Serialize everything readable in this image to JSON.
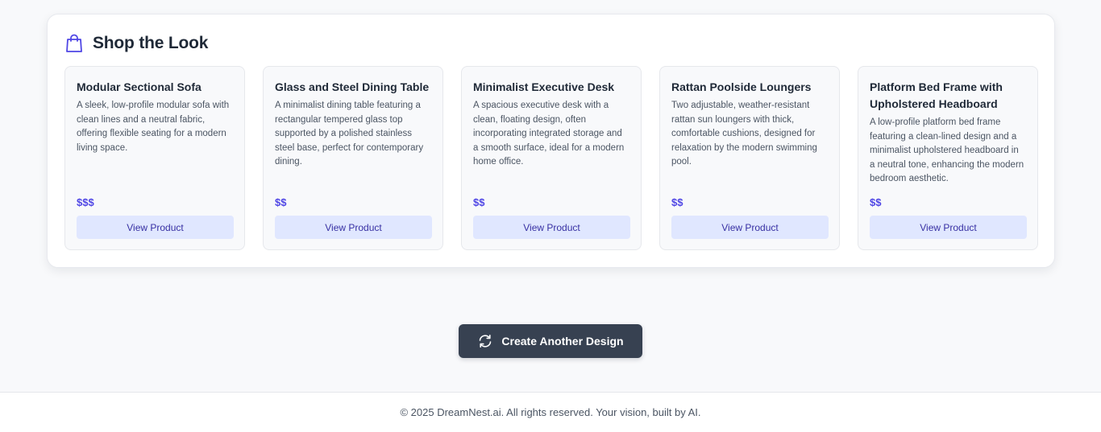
{
  "shop": {
    "title": "Shop the Look",
    "icon": "shopping-bag-icon",
    "accent_color": "#4f46e5",
    "products": [
      {
        "name": "Modular Sectional Sofa",
        "description": "A sleek, low-profile modular sofa with clean lines and a neutral fabric, offering flexible seating for a modern living space.",
        "price": "$$$",
        "button_label": "View Product"
      },
      {
        "name": "Glass and Steel Dining Table",
        "description": "A minimalist dining table featuring a rectangular tempered glass top supported by a polished stainless steel base, perfect for contemporary dining.",
        "price": "$$",
        "button_label": "View Product"
      },
      {
        "name": "Minimalist Executive Desk",
        "description": "A spacious executive desk with a clean, floating design, often incorporating integrated storage and a smooth surface, ideal for a modern home office.",
        "price": "$$",
        "button_label": "View Product"
      },
      {
        "name": "Rattan Poolside Loungers",
        "description": "Two adjustable, weather-resistant rattan sun loungers with thick, comfortable cushions, designed for relaxation by the modern swimming pool.",
        "price": "$$",
        "button_label": "View Product"
      },
      {
        "name": "Platform Bed Frame with Upholstered Headboard",
        "description": "A low-profile platform bed frame featuring a clean-lined design and a minimalist upholstered headboard in a neutral tone, enhancing the modern bedroom aesthetic.",
        "price": "$$",
        "button_label": "View Product"
      }
    ]
  },
  "actions": {
    "create_another_label": "Create Another Design",
    "create_icon": "refresh-icon",
    "button_color": "#374151"
  },
  "footer": {
    "text": "© 2025 DreamNest.ai. All rights reserved. Your vision, built by AI."
  }
}
